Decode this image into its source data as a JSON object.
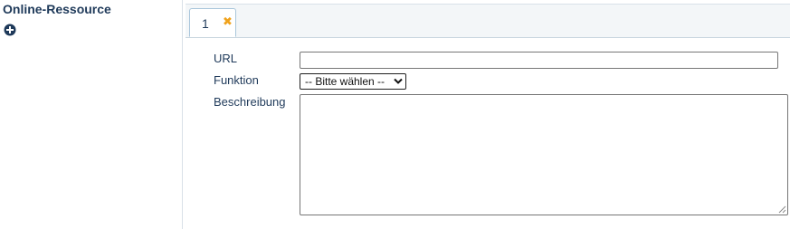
{
  "section": {
    "label": "Online-Ressource",
    "add_icon": "plus-circle-icon"
  },
  "tabs": [
    {
      "label": "1",
      "close_icon": "close-icon",
      "close_glyph": "✖"
    }
  ],
  "form": {
    "url_label": "URL",
    "url_value": "",
    "function_label": "Funktion",
    "function_selected": "-- Bitte wählen --",
    "description_label": "Beschreibung",
    "description_value": ""
  },
  "colors": {
    "label_text": "#1f3a5a",
    "close_icon": "#f0a21c",
    "tab_border": "#a9c6db",
    "tab_strip_bg": "#f3f6f8"
  }
}
